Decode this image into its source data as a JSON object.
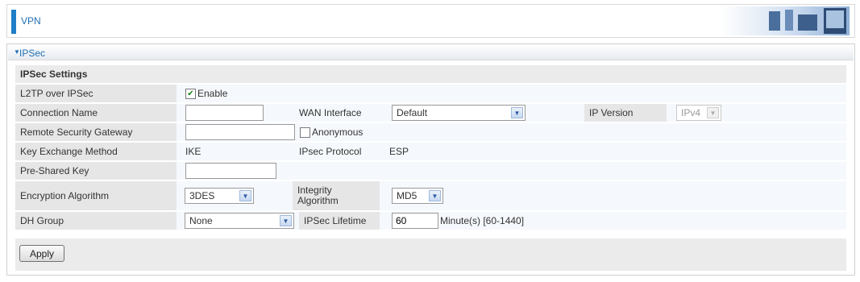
{
  "header": {
    "title": "VPN"
  },
  "section": {
    "title": "IPSec",
    "subtitle": "IPSec Settings"
  },
  "fields": {
    "l2tp": {
      "label": "L2TP over IPSec",
      "checkbox_label": "Enable",
      "checked": true
    },
    "connection_name": {
      "label": "Connection Name",
      "value": ""
    },
    "wan_interface": {
      "label": "WAN Interface",
      "selected": "Default"
    },
    "ip_version": {
      "label": "IP Version",
      "selected": "IPv4"
    },
    "remote_gateway": {
      "label": "Remote Security Gateway",
      "value": "",
      "checkbox_label": "Anonymous",
      "checked": false
    },
    "key_exchange": {
      "label": "Key Exchange Method",
      "value": "IKE"
    },
    "ipsec_protocol": {
      "label": "IPsec Protocol",
      "value": "ESP"
    },
    "psk": {
      "label": "Pre-Shared Key",
      "value": ""
    },
    "encryption": {
      "label": "Encryption Algorithm",
      "selected": "3DES"
    },
    "integrity": {
      "label": "Integrity Algorithm",
      "selected": "MD5"
    },
    "dh_group": {
      "label": "DH Group",
      "selected": "None"
    },
    "lifetime": {
      "label": "IPSec Lifetime",
      "value": "60",
      "unit": "Minute(s) [60-1440]"
    }
  },
  "buttons": {
    "apply": "Apply"
  }
}
